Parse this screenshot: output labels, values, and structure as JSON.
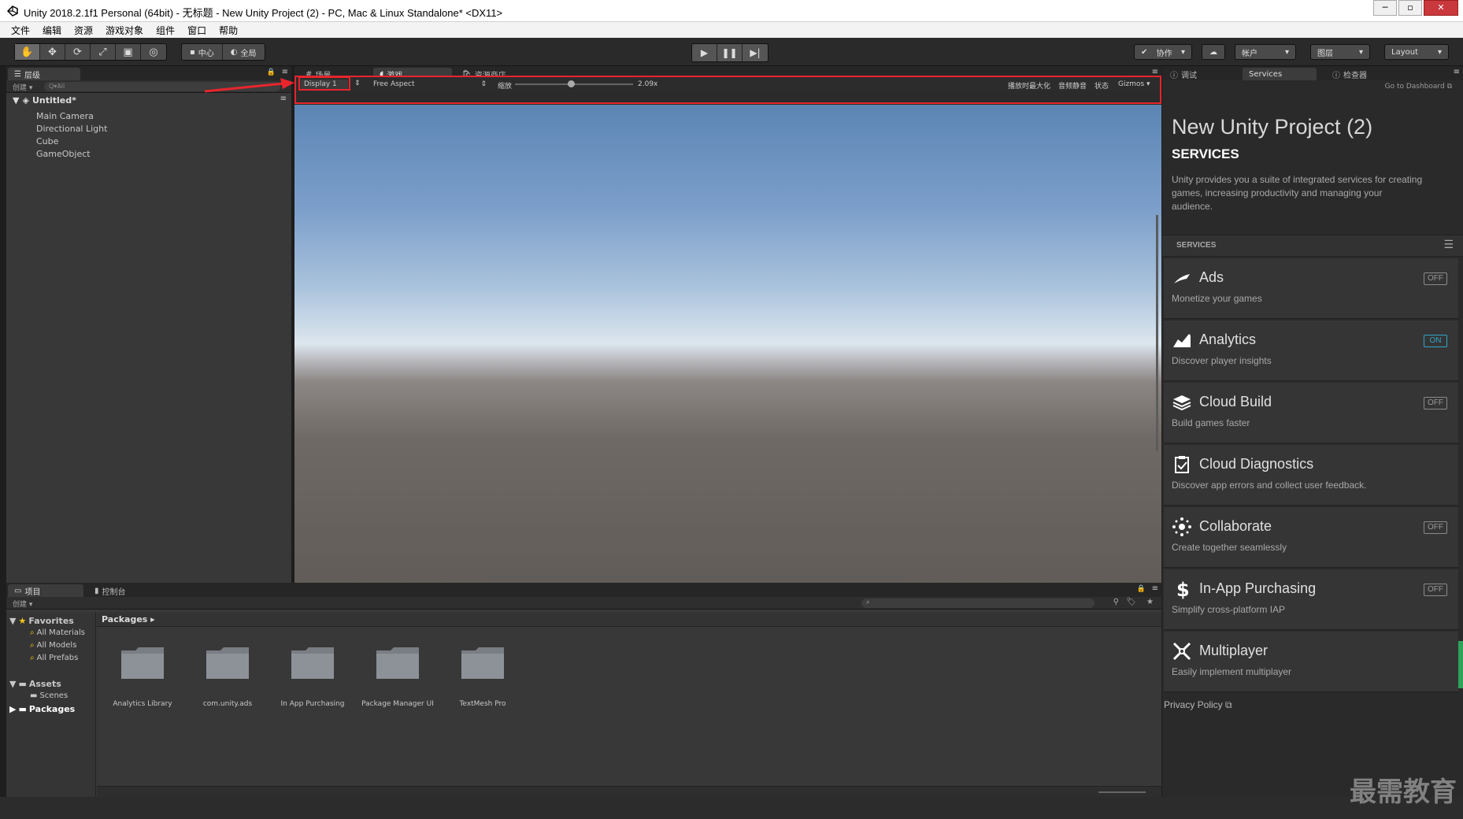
{
  "window": {
    "title": "Unity 2018.2.1f1 Personal (64bit) - 无标题 - New Unity Project (2) - PC, Mac & Linux Standalone* <DX11>"
  },
  "menubar": [
    "文件",
    "编辑",
    "资源",
    "游戏对象",
    "组件",
    "窗口",
    "帮助"
  ],
  "toolbar": {
    "tools": [
      "hand-icon",
      "move-icon",
      "rotate-icon",
      "scale-icon",
      "rect-icon",
      "transform-icon"
    ],
    "pivot": "中心",
    "global": "全局",
    "collab": "协作",
    "account": "帐户",
    "layers": "图层",
    "layout": "Layout"
  },
  "hierarchy": {
    "tab": "层级",
    "create": "创建",
    "search_placeholder": "Q▾All",
    "scene": "Untitled*",
    "items": [
      "Main Camera",
      "Directional Light",
      "Cube",
      "GameObject"
    ]
  },
  "game": {
    "tabs": [
      "场景",
      "游戏",
      "资源商店"
    ],
    "display": "Display 1",
    "aspect": "Free Aspect",
    "scale_label": "缩放",
    "scale_value": "2.09x",
    "options": [
      "播放时最大化",
      "音频静音",
      "状态",
      "Gizmos"
    ]
  },
  "inspector": {
    "tabs": [
      "调试",
      "Services",
      "检查器"
    ],
    "dashboard": "Go to Dashboard",
    "project_title": "New Unity Project (2)",
    "section_title": "SERVICES",
    "description": "Unity provides you a suite of integrated services for creating games, increasing productivity and managing your audience.",
    "services_label": "SERVICES",
    "privacy": "Privacy Policy",
    "services": [
      {
        "name": "Ads",
        "desc": "Monetize your games",
        "status": "OFF",
        "icon": "ads-icon"
      },
      {
        "name": "Analytics",
        "desc": "Discover player insights",
        "status": "ON",
        "icon": "analytics-icon"
      },
      {
        "name": "Cloud Build",
        "desc": "Build games faster",
        "status": "OFF",
        "icon": "cloud-build-icon"
      },
      {
        "name": "Cloud Diagnostics",
        "desc": "Discover app errors and collect user feedback.",
        "status": "",
        "icon": "clipboard-icon"
      },
      {
        "name": "Collaborate",
        "desc": "Create together seamlessly",
        "status": "OFF",
        "icon": "collaborate-icon"
      },
      {
        "name": "In-App Purchasing",
        "desc": "Simplify cross-platform IAP",
        "status": "OFF",
        "icon": "dollar-icon"
      },
      {
        "name": "Multiplayer",
        "desc": "Easily implement multiplayer",
        "status": "",
        "icon": "multiplayer-icon"
      }
    ]
  },
  "project": {
    "tabs": [
      "项目",
      "控制台"
    ],
    "create": "创建",
    "favorites": "Favorites",
    "favorite_items": [
      "All Materials",
      "All Models",
      "All Prefabs"
    ],
    "assets": "Assets",
    "scenes": "Scenes",
    "packages": "Packages",
    "breadcrumb": "Packages",
    "folders": [
      "Analytics Library",
      "com.unity.ads",
      "In App Purchasing",
      "Package Manager UI",
      "TextMesh Pro"
    ]
  },
  "watermark": "最需教育",
  "colors": {
    "highlight": "#e8252d",
    "on_badge": "#2fa6c9"
  }
}
